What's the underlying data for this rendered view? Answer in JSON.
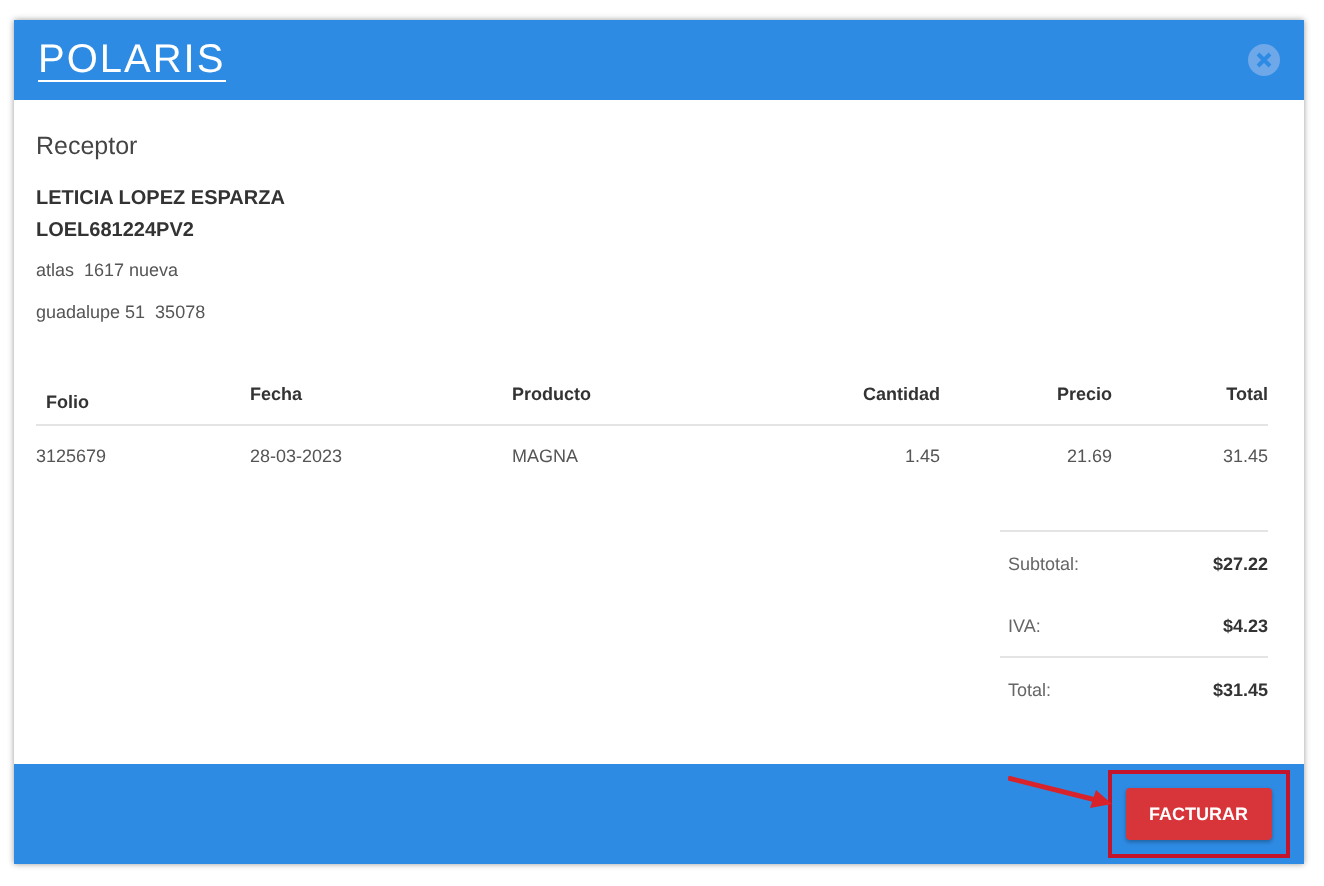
{
  "header": {
    "logo": "POLARIS"
  },
  "receptor": {
    "heading": "Receptor",
    "name": "LETICIA LOPEZ ESPARZA",
    "rfc": "LOEL681224PV2",
    "address_line_1": "atlas  1617 nueva",
    "address_line_2": "guadalupe 51  35078"
  },
  "table": {
    "columns": [
      "Folio",
      "Fecha",
      "Producto",
      "Cantidad",
      "Precio",
      "Total"
    ],
    "rows": [
      [
        "3125679",
        "28-03-2023",
        "MAGNA",
        "1.45",
        "21.69",
        "31.45"
      ]
    ]
  },
  "totals": [
    {
      "label": "Subtotal:",
      "value": "$27.22"
    },
    {
      "label": "IVA:",
      "value": "$4.23"
    },
    {
      "label": "Total:",
      "value": "$31.45"
    }
  ],
  "footer": {
    "button": "FACTURAR",
    "highlighted": true
  }
}
